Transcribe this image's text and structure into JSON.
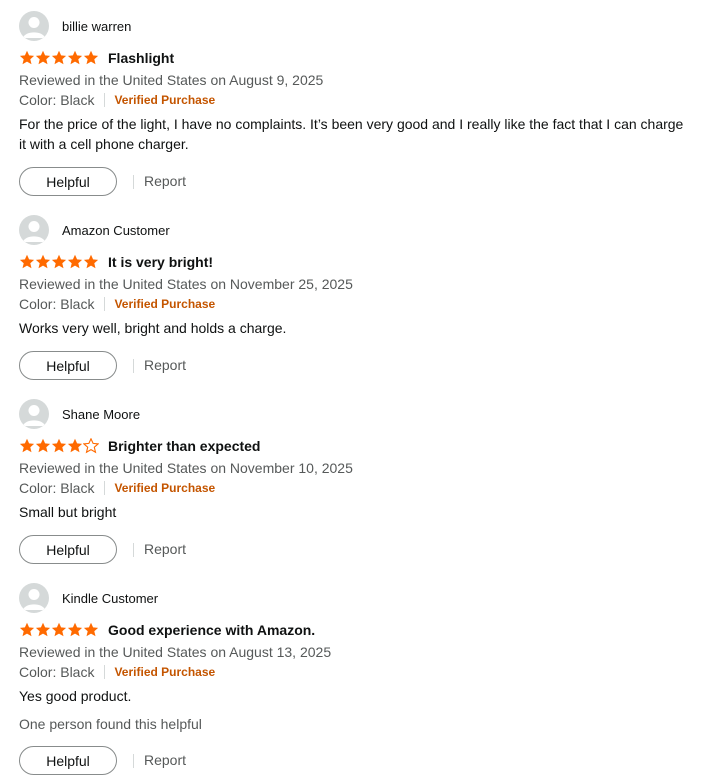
{
  "colors": {
    "star": "#ff6a00",
    "verified": "#c45500",
    "muted": "#565959"
  },
  "reviews": [
    {
      "name": "billie warren",
      "rating": 5,
      "title": "Flashlight",
      "date": "Reviewed in the United States on August 9, 2025",
      "color": "Color: Black",
      "verified": "Verified Purchase",
      "body": "For the price of the light, I have no complaints. It’s been very good and I really like the fact that I can charge it with a cell phone charger.",
      "helpful_label": "Helpful",
      "report_label": "Report"
    },
    {
      "name": "Amazon Customer",
      "rating": 5,
      "title": "It is very bright!",
      "date": "Reviewed in the United States on November 25, 2025",
      "color": "Color: Black",
      "verified": "Verified Purchase",
      "body": "Works very well, bright and holds a charge.",
      "helpful_label": "Helpful",
      "report_label": "Report"
    },
    {
      "name": "Shane Moore",
      "rating": 4,
      "title": "Brighter than expected",
      "date": "Reviewed in the United States on November 10, 2025",
      "color": "Color: Black",
      "verified": "Verified Purchase",
      "body": "Small but bright",
      "helpful_label": "Helpful",
      "report_label": "Report"
    },
    {
      "name": "Kindle Customer",
      "rating": 5,
      "title": "Good experience with Amazon.",
      "date": "Reviewed in the United States on August 13, 2025",
      "color": "Color: Black",
      "verified": "Verified Purchase",
      "body": "Yes good product.",
      "found_helpful": "One person found this helpful",
      "helpful_label": "Helpful",
      "report_label": "Report"
    }
  ]
}
